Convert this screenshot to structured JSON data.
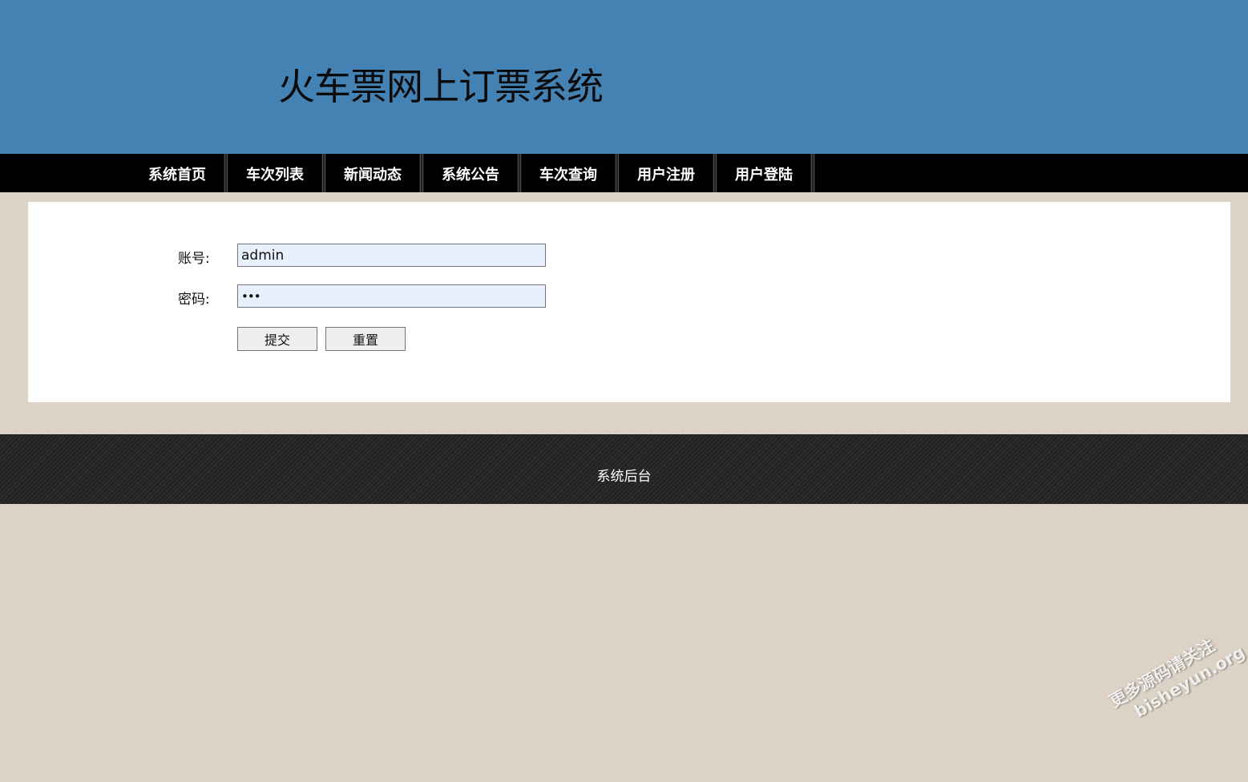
{
  "header": {
    "title": "火车票网上订票系统",
    "background_color": "#4582b4"
  },
  "nav": {
    "items": [
      {
        "label": "系统首页"
      },
      {
        "label": "车次列表"
      },
      {
        "label": "新闻动态"
      },
      {
        "label": "系统公告"
      },
      {
        "label": "车次查询"
      },
      {
        "label": "用户注册"
      },
      {
        "label": "用户登陆"
      }
    ]
  },
  "login_form": {
    "account_label": "账号:",
    "account_value": "admin",
    "password_label": "密码:",
    "password_value": "•••",
    "submit_label": "提交",
    "reset_label": "重置"
  },
  "footer": {
    "link_label": "系统后台"
  },
  "watermark": {
    "line1": "更多源码请关注",
    "line2": "bisheyun.org"
  },
  "colors": {
    "page_background": "#dcd3c6",
    "nav_background": "#000000",
    "input_background": "#e8f0fe",
    "footer_background": "#262626"
  }
}
